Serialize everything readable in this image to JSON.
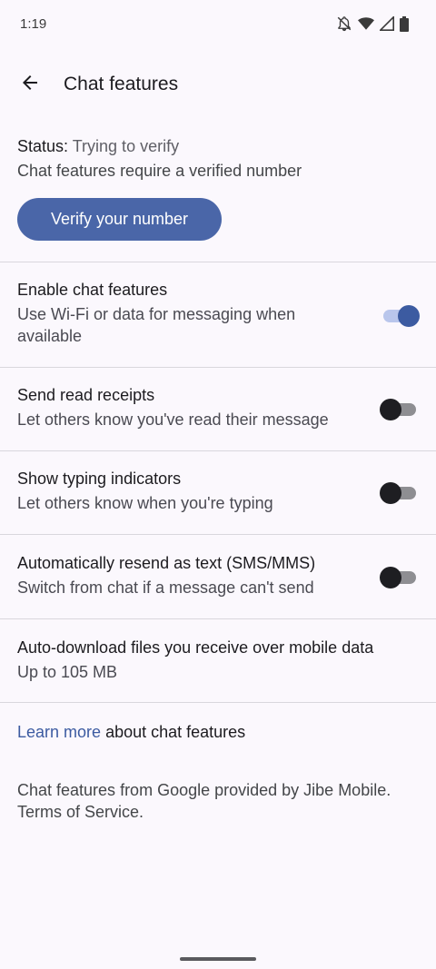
{
  "status_bar": {
    "time": "1:19",
    "icons": [
      "bell-off-icon",
      "wifi-icon",
      "signal-icon",
      "battery-icon"
    ]
  },
  "app_bar": {
    "back_icon": "arrow-back-icon",
    "title": "Chat features"
  },
  "status": {
    "label": "Status:",
    "value": "Trying to verify",
    "description": "Chat features require a verified number",
    "verify_button": "Verify your number"
  },
  "settings": [
    {
      "title": "Enable chat features",
      "subtitle": "Use Wi-Fi or data for messaging when available",
      "toggle": true
    },
    {
      "title": "Send read receipts",
      "subtitle": "Let others know you've read their message",
      "toggle": false
    },
    {
      "title": "Show typing indicators",
      "subtitle": "Let others know when you're typing",
      "toggle": false
    },
    {
      "title": "Automatically resend as text (SMS/MMS)",
      "subtitle": "Switch from chat if a message can't send",
      "toggle": false
    },
    {
      "title": "Auto-download files you receive over mobile data",
      "subtitle": "Up to 105 MB"
    }
  ],
  "learn_more": {
    "link": "Learn more",
    "text": " about chat features"
  },
  "footer": "Chat features from Google provided by Jibe Mobile. Terms of Service.",
  "colors": {
    "accent": "#3C5BA1",
    "button": "#4A66A8",
    "background": "#FBF8FD"
  }
}
